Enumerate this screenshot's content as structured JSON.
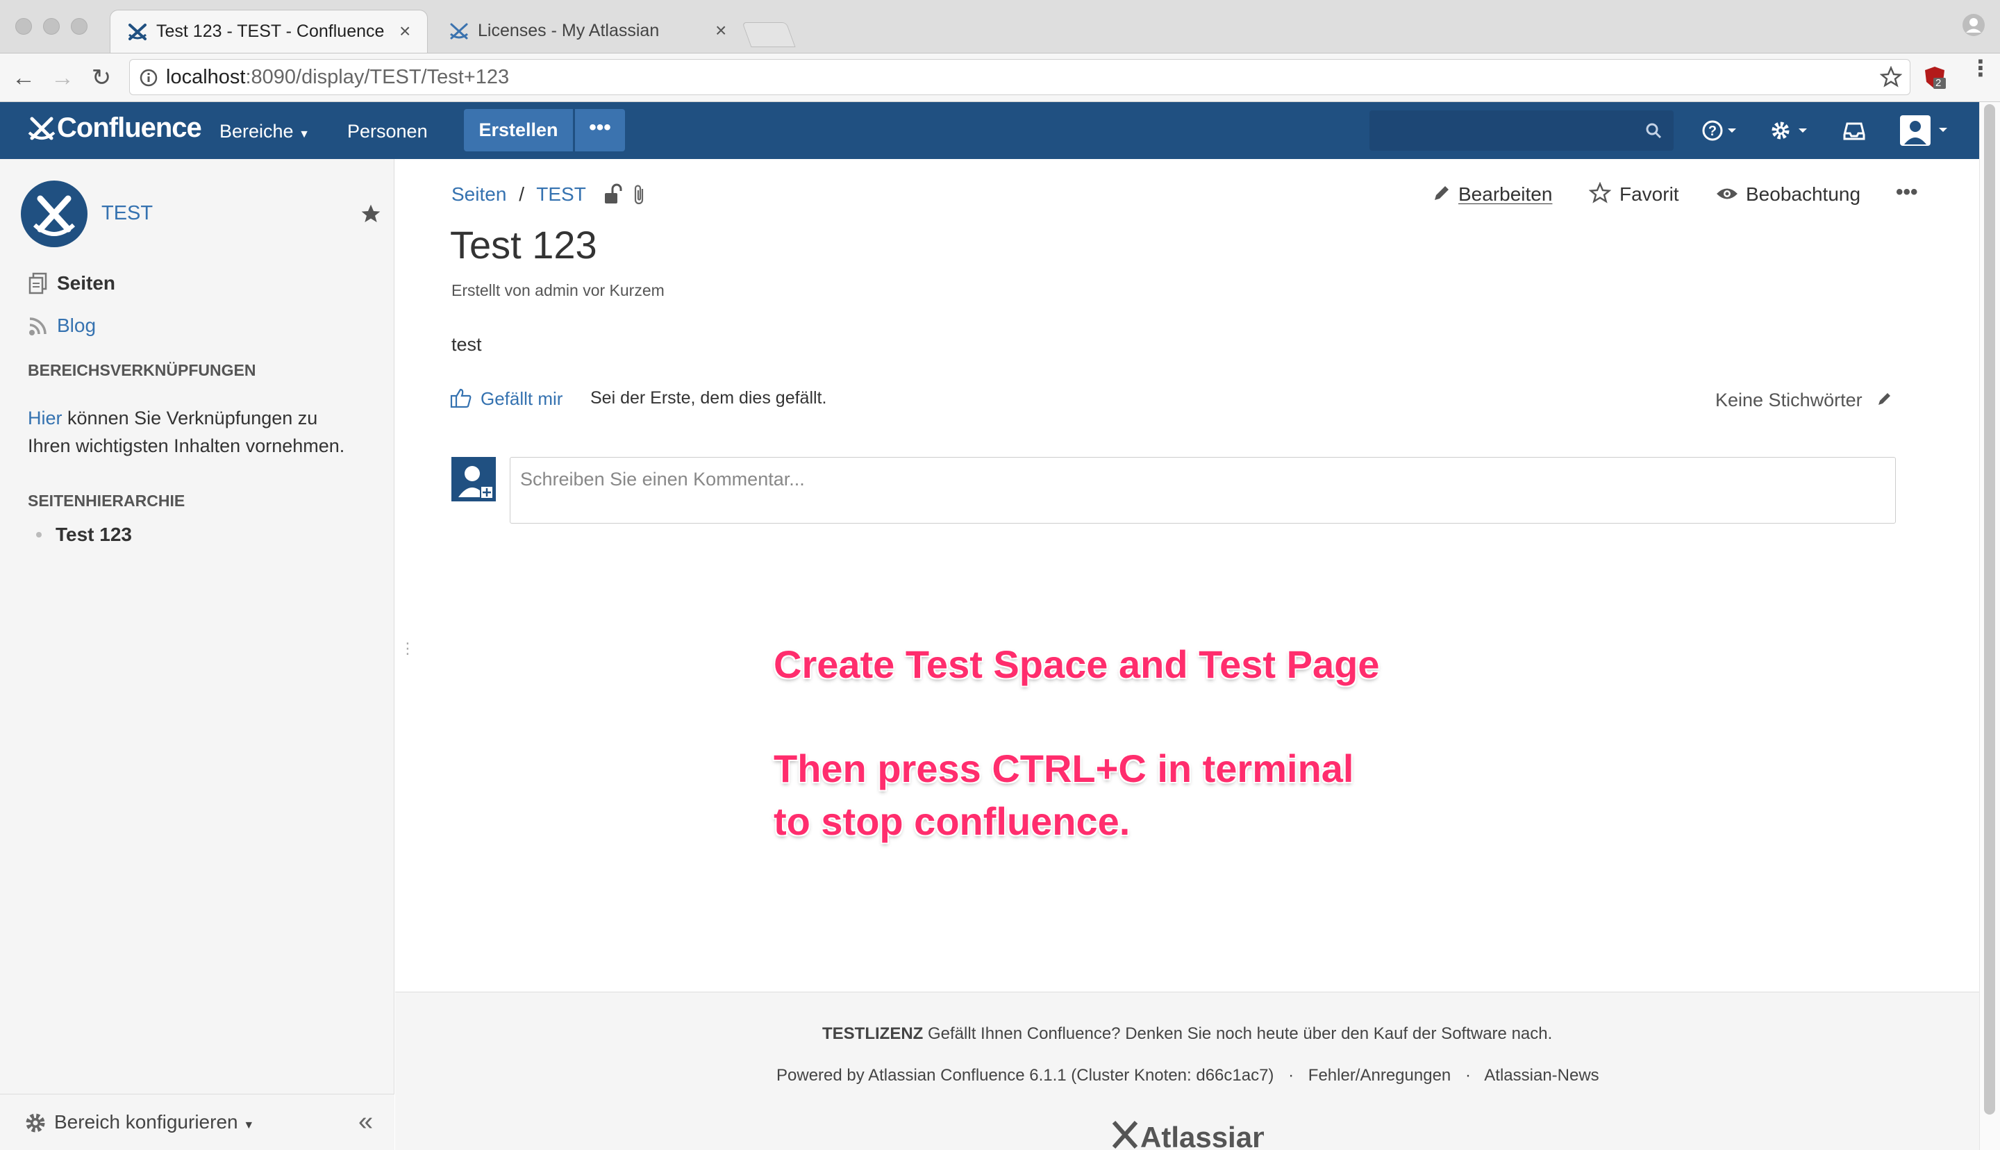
{
  "browser": {
    "tabs": [
      {
        "title": "Test 123 - TEST - Confluence",
        "close": "×"
      },
      {
        "title": "Licenses - My Atlassian",
        "close": "×"
      }
    ],
    "url_host": "localhost",
    "url_rest": ":8090/display/TEST/Test+123",
    "extension_badge": "2"
  },
  "header": {
    "logo_text": "Confluence",
    "nav": {
      "spaces": "Bereiche",
      "people": "Personen"
    },
    "create": "Erstellen",
    "more": "•••"
  },
  "sidebar": {
    "space_name": "TEST",
    "pages": "Seiten",
    "blog": "Blog",
    "shortcuts_heading": "BEREICHSVERKNÜPFUNGEN",
    "shortcuts_link": "Hier",
    "shortcuts_text1": "können Sie Verknüpfungen zu",
    "shortcuts_text2": "Ihren wichtigsten Inhalten vornehmen.",
    "hierarchy_heading": "SEITENHIERARCHIE",
    "hierarchy_items": [
      "Test 123"
    ],
    "configure": "Bereich konfigurieren",
    "collapse": "«"
  },
  "page": {
    "breadcrumb": {
      "pages": "Seiten",
      "sep": "/",
      "space": "TEST"
    },
    "actions": {
      "edit": "Bearbeiten",
      "favorite": "Favorit",
      "watch": "Beobachtung",
      "more": "•••"
    },
    "title": "Test 123",
    "byline": "Erstellt von admin vor Kurzem",
    "body": "test",
    "like": "Gefällt mir",
    "like_text": "Sei der Erste, dem dies gefällt.",
    "labels": "Keine Stichwörter",
    "comment_placeholder": "Schreiben Sie einen Kommentar..."
  },
  "annotation": {
    "line1": "Create Test Space and Test Page",
    "line2": "Then press CTRL+C in terminal",
    "line3": "to stop confluence."
  },
  "footer": {
    "license_bold": "TESTLIZENZ",
    "license_text": "Gefällt Ihnen Confluence? Denken Sie noch heute über den Kauf der Software nach.",
    "powered": "Powered by Atlassian Confluence 6.1.1 (Cluster Knoten: d66c1ac7)",
    "dot": "·",
    "feedback": "Fehler/Anregungen",
    "news": "Atlassian-News",
    "atlassian_logo": "Atlassian"
  },
  "colors": {
    "header_bg": "#205081",
    "button_bg": "#3b73af",
    "link": "#3572b0",
    "annotation": "#ff2d6d"
  },
  "icons": [
    "confluence-logo-icon",
    "search-icon",
    "help-icon",
    "gear-icon",
    "notifications-icon",
    "user-avatar-icon",
    "star-icon",
    "pages-icon",
    "rss-icon",
    "unlock-icon",
    "paperclip-icon",
    "pencil-icon",
    "eye-icon",
    "thumbs-up-icon",
    "tag-pencil-icon"
  ]
}
